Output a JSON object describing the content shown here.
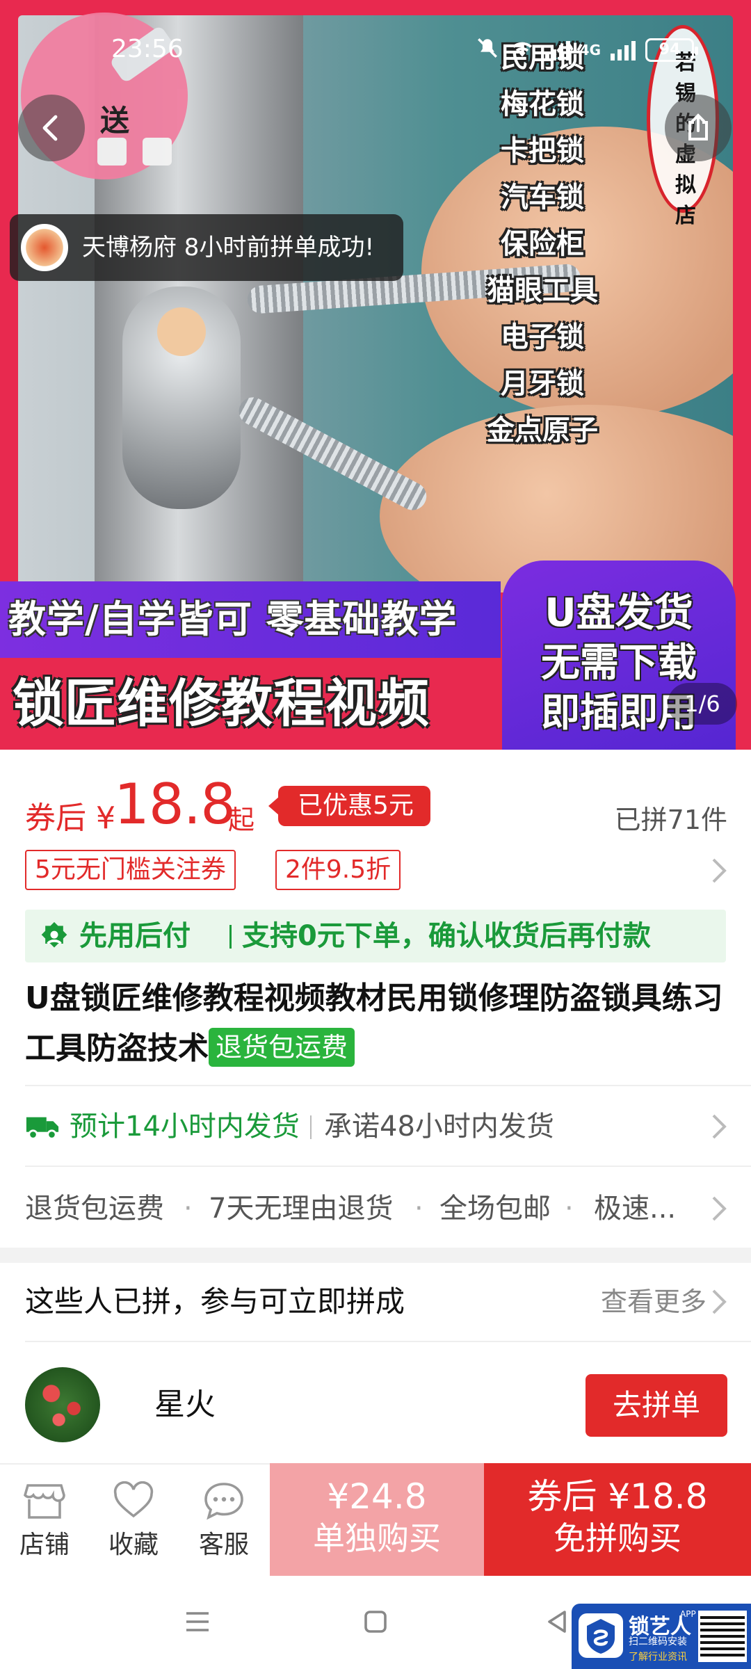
{
  "status_bar": {
    "time": "23:56",
    "battery": "94",
    "network": "4G"
  },
  "hero": {
    "gift_label": "送",
    "lock_types": [
      "民用锁",
      "梅花锁",
      "卡把锁",
      "汽车锁",
      "保险柜",
      "猫眼工具",
      "电子锁",
      "月牙锁",
      "金点原子"
    ],
    "shop_stamp": "若锡的虚拟店",
    "banner_top": "教学/自学皆可  零基础教学",
    "banner_main": "锁匠维修教程视频",
    "usb_box_lines": [
      "U盘发货",
      "无需下载",
      "即插即用"
    ],
    "page_indicator": "1/6"
  },
  "toast": {
    "text": "天博杨府 8小时前拼单成功!"
  },
  "price": {
    "prefix": "券后 ¥",
    "value": "18.8",
    "suffix": "起",
    "discount_badge": "已优惠5元",
    "sold_count": "已拼71件"
  },
  "coupons": [
    "5元无门槛关注券",
    "2件9.5折"
  ],
  "pay_after": {
    "label": "先用后付",
    "desc": "支持0元下单，确认收货后再付款"
  },
  "product": {
    "title": "U盘锁匠维修教程视频教材民用锁修理防盗锁具练习工具防盗技术",
    "tag": "退货包运费"
  },
  "shipping": {
    "estimate": "预计14小时内发货",
    "promise": "承诺48小时内发货"
  },
  "services": [
    "退货包运费",
    "7天无理由退货",
    "全场包邮",
    "极速..."
  ],
  "group_buy": {
    "title": "这些人已拼，参与可立即拼成",
    "more": "查看更多",
    "items": [
      {
        "name": "星火",
        "button": "去拼单"
      }
    ]
  },
  "action_bar": {
    "shop": "店铺",
    "favorite": "收藏",
    "service": "客服",
    "buy_alone_price": "¥24.8",
    "buy_alone_label": "单独购买",
    "buy_group_price": "券后 ¥18.8",
    "buy_group_label": "免拼购买"
  },
  "watermark": {
    "title": "锁艺人",
    "app": "APP",
    "sub1": "扫二维码安装",
    "sub2": "了解行业资讯"
  },
  "colors": {
    "accent_red": "#e22a2a",
    "green": "#1a9a3a",
    "hero_pink": "#e8294f",
    "banner_purple": "#6a2ce0"
  }
}
